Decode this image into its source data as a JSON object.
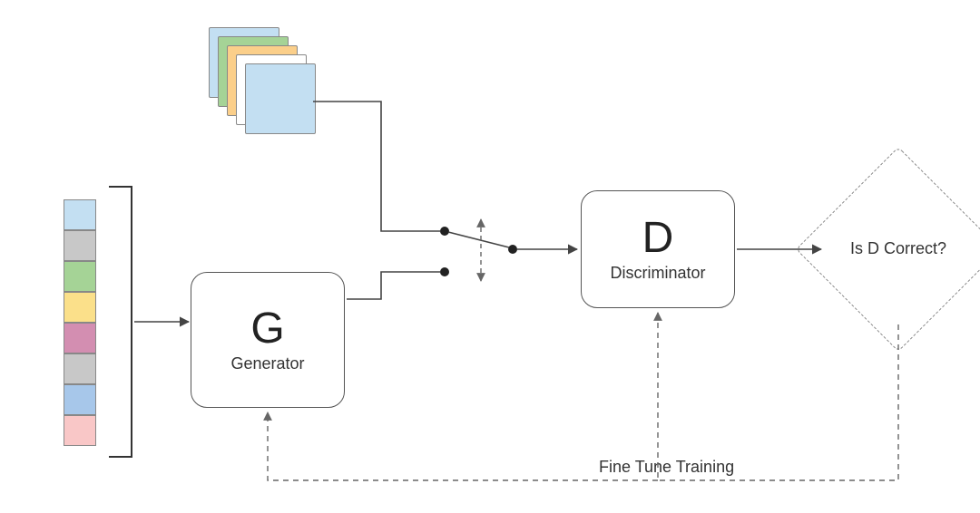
{
  "input_vector": {
    "colors": [
      "#c3dff2",
      "#c8c8c8",
      "#a5d396",
      "#fbe08a",
      "#d38eb1",
      "#c8c8c8",
      "#a7c7ea",
      "#f9c7c7"
    ]
  },
  "real_images_stack": {
    "count": 5,
    "card_colors": [
      "#c3dff2",
      "#a5d396",
      "#fbcf8a",
      "#ffffff",
      "#c3dff2"
    ]
  },
  "generator": {
    "symbol": "G",
    "label": "Generator"
  },
  "discriminator": {
    "symbol": "D",
    "label": "Discriminator"
  },
  "decision": {
    "text": "Is D Correct?"
  },
  "feedback": {
    "label": "Fine Tune Training"
  },
  "switch": {
    "description": "Switch between real and generated samples"
  },
  "edges": [
    {
      "from": "input-vector",
      "to": "generator",
      "style": "solid"
    },
    {
      "from": "real-images",
      "to": "switch",
      "style": "solid"
    },
    {
      "from": "generator",
      "to": "switch",
      "style": "solid"
    },
    {
      "from": "switch",
      "to": "discriminator",
      "style": "solid"
    },
    {
      "from": "discriminator",
      "to": "decision",
      "style": "solid"
    },
    {
      "from": "decision",
      "to": "discriminator",
      "style": "dashed",
      "label": "Fine Tune Training"
    },
    {
      "from": "decision",
      "to": "generator",
      "style": "dashed",
      "label": "Fine Tune Training"
    }
  ]
}
